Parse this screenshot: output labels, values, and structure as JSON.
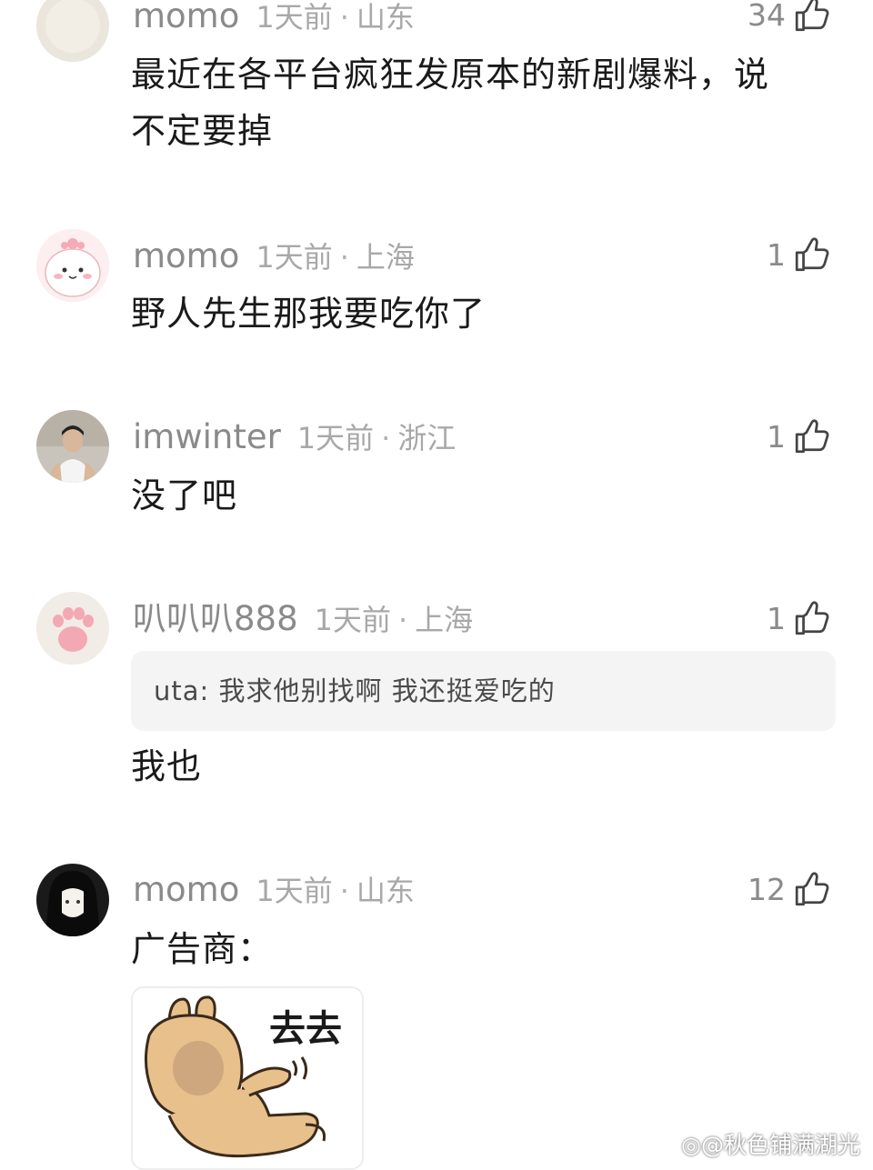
{
  "comments": [
    {
      "username": "momo",
      "time": "1天前",
      "location": "山东",
      "likes": "34",
      "text_line1": "最近在各平台疯狂发原本的新剧爆料，说",
      "text_line2": "不定要掉"
    },
    {
      "username": "momo",
      "time": "1天前",
      "location": "上海",
      "likes": "1",
      "text": "野人先生那我要吃你了"
    },
    {
      "username": "imwinter",
      "time": "1天前",
      "location": "浙江",
      "likes": "1",
      "text": "没了吧"
    },
    {
      "username": "叭叭叭888",
      "time": "1天前",
      "location": "上海",
      "likes": "1",
      "quote": "uta: 我求他别找啊 我还挺爱吃的",
      "text": "我也"
    },
    {
      "username": "momo",
      "time": "1天前",
      "location": "山东",
      "likes": "12",
      "text": "广告商：",
      "sticker_text": "去去"
    }
  ],
  "watermark": "@秋色铺满湖光",
  "icons": {
    "like": "thumbs-up-outline-icon",
    "watermark_logo": "weibo-logo-icon"
  }
}
